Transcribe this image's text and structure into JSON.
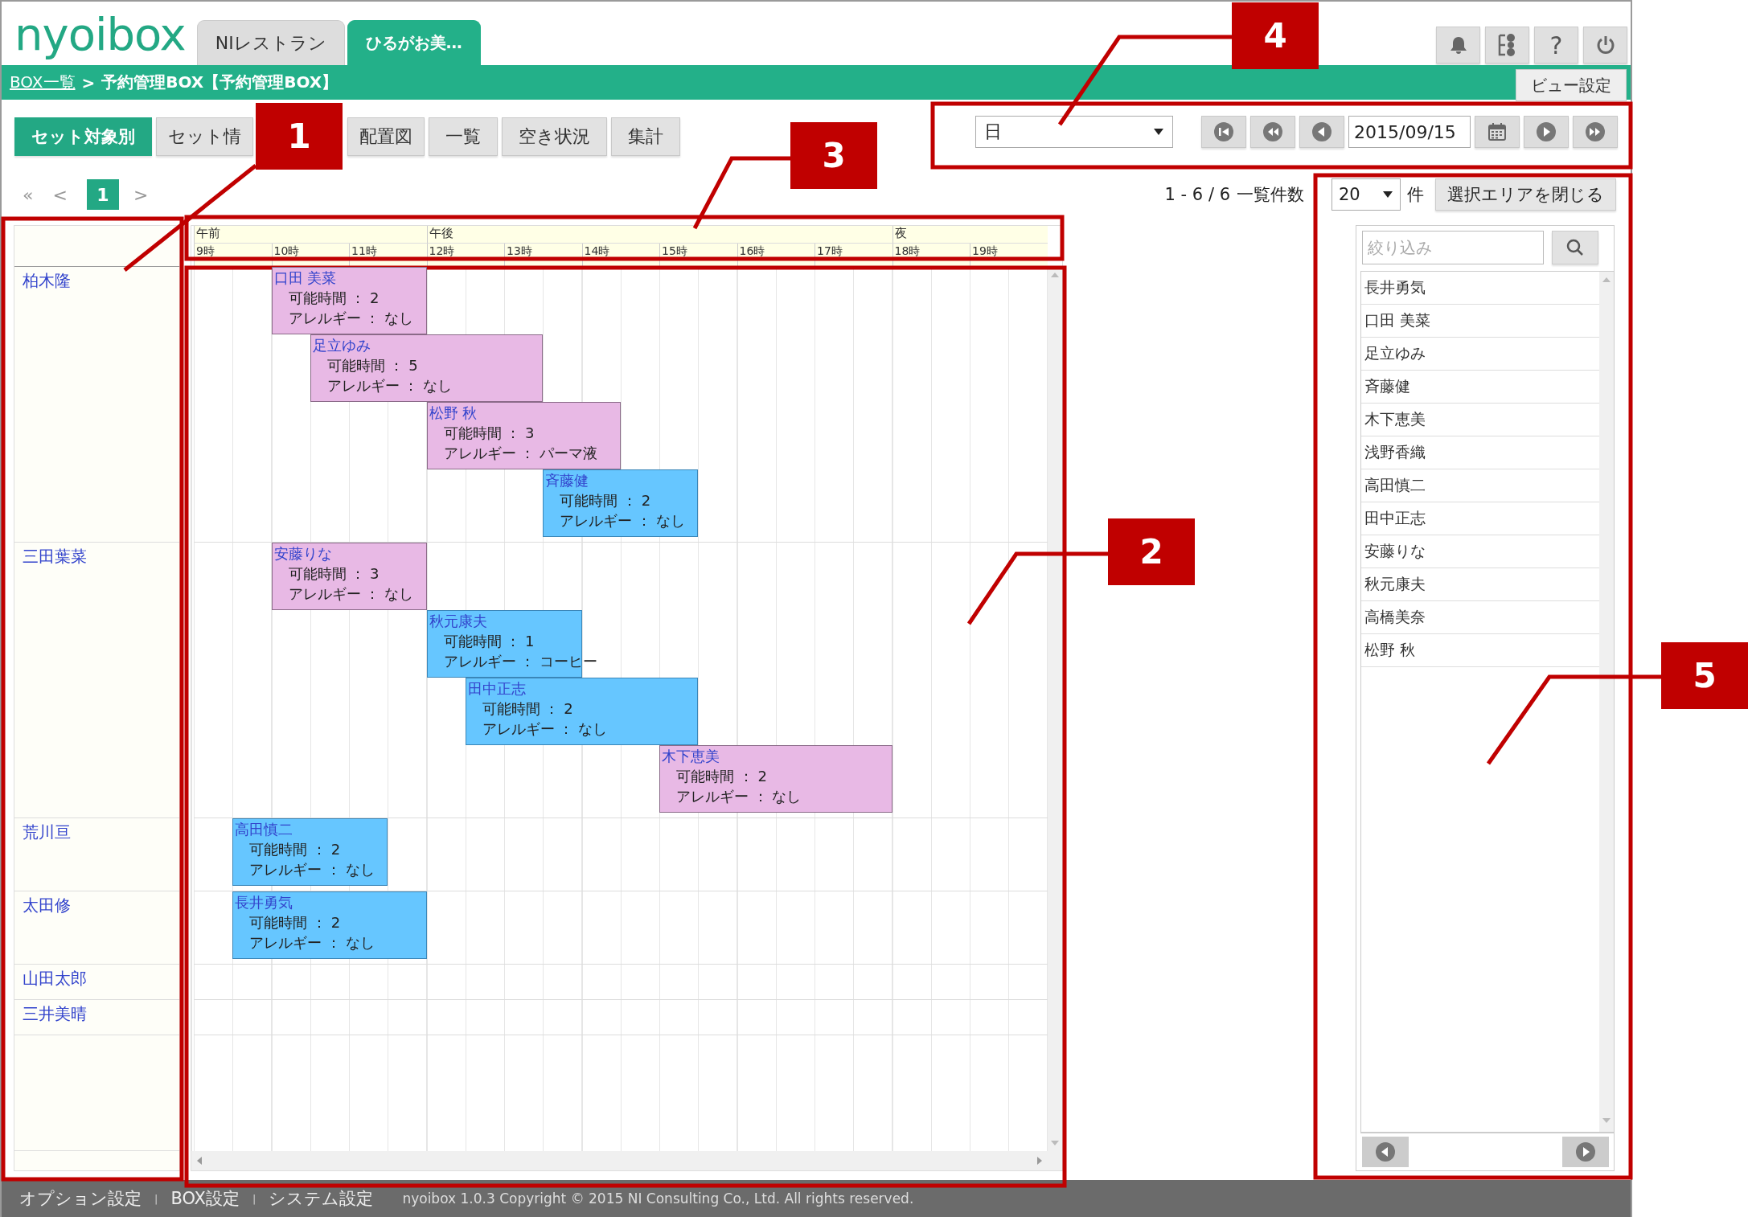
{
  "header": {
    "logo": "nyoibox",
    "tabs": [
      {
        "label": "NIレストラン",
        "selected": false
      },
      {
        "label": "ひるがお美…",
        "selected": true
      }
    ],
    "tool_buttons": [
      {
        "kind": "bell"
      },
      {
        "kind": "org"
      },
      {
        "kind": "help",
        "label": "?"
      },
      {
        "kind": "power"
      }
    ]
  },
  "breadcrumb": {
    "link": "BOX一覧",
    "separator": ">",
    "current": "予約管理BOX【予約管理BOX】"
  },
  "view_settings": "ビュー設定",
  "view_tabs": [
    {
      "label": "セット対象別",
      "selected": true
    },
    {
      "label": "セット情",
      "selected": false
    },
    {
      "label": "配置図",
      "selected": false
    },
    {
      "label": "一覧",
      "selected": false
    },
    {
      "label": "空き状況",
      "selected": false
    },
    {
      "label": "集計",
      "selected": false
    }
  ],
  "date_nav": {
    "period": "日",
    "date": "2015/09/15"
  },
  "pagination": {
    "first": "«",
    "prev": "<",
    "pages": [
      {
        "label": "1",
        "selected": true
      }
    ],
    "next": ">"
  },
  "count": {
    "range": "1 - 6 / 6",
    "label": "一覧件数",
    "page_size": "20",
    "unit": "件"
  },
  "close_selection": "選択エリアを閉じる",
  "timeline": {
    "periods": [
      {
        "label": "午前"
      },
      {
        "label": "午後"
      },
      {
        "label": "夜"
      }
    ],
    "hours": [
      "9時",
      "10時",
      "11時",
      "12時",
      "13時",
      "14時",
      "15時",
      "16時",
      "17時",
      "18時",
      "19時"
    ]
  },
  "rows": [
    {
      "name": "柏木隆",
      "bookings": [
        {
          "name": "口田 美菜",
          "details": [
            "可能時間 ： 2",
            "アレルギー ： なし"
          ],
          "color": "#e8b9e5"
        },
        {
          "name": "足立ゆみ",
          "details": [
            "可能時間 ： 5",
            "アレルギー ： なし"
          ],
          "color": "#e8b9e5"
        },
        {
          "name": "松野 秋",
          "details": [
            "可能時間 ： 3",
            "アレルギー ： パーマ液"
          ],
          "color": "#e8b9e5"
        },
        {
          "name": "斉藤健",
          "details": [
            "可能時間 ： 2",
            "アレルギー ： なし"
          ],
          "color": "#66c6ff"
        }
      ]
    },
    {
      "name": "三田葉菜",
      "bookings": [
        {
          "name": "安藤りな",
          "details": [
            "可能時間 ： 3",
            "アレルギー ： なし"
          ],
          "color": "#e8b9e5"
        },
        {
          "name": "秋元康夫",
          "details": [
            "可能時間 ： 1",
            "アレルギー ： コーヒー"
          ],
          "color": "#66c6ff"
        },
        {
          "name": "田中正志",
          "details": [
            "可能時間 ： 2",
            "アレルギー ： なし"
          ],
          "color": "#66c6ff"
        },
        {
          "name": "木下恵美",
          "details": [
            "可能時間 ： 2",
            "アレルギー ： なし"
          ],
          "color": "#e8b9e5"
        }
      ]
    },
    {
      "name": "荒川亘",
      "bookings": [
        {
          "name": "高田慎二",
          "details": [
            "可能時間 ： 2",
            "アレルギー ： なし"
          ],
          "color": "#66c6ff"
        }
      ]
    },
    {
      "name": "太田修",
      "bookings": [
        {
          "name": "長井勇気",
          "details": [
            "可能時間 ： 2",
            "アレルギー ： なし"
          ],
          "color": "#66c6ff"
        }
      ]
    },
    {
      "name": "山田太郎",
      "bookings": []
    },
    {
      "name": "三井美晴",
      "bookings": []
    }
  ],
  "side_panel": {
    "filter": {
      "placeholder": "絞り込み"
    },
    "candidates": [
      "長井勇気",
      "口田 美菜",
      "足立ゆみ",
      "斉藤健",
      "木下恵美",
      "浅野香織",
      "高田慎二",
      "田中正志",
      "安藤りな",
      "秋元康夫",
      "高橋美奈",
      "松野 秋"
    ]
  },
  "footer": {
    "items": [
      {
        "kind": "link",
        "text": "オプション設定"
      },
      {
        "kind": "separator",
        "text": "|"
      },
      {
        "kind": "link",
        "text": "BOX設定"
      },
      {
        "kind": "separator",
        "text": "|"
      },
      {
        "kind": "link",
        "text": "システム設定"
      }
    ],
    "copyright": "nyoibox 1.0.3 Copyright © 2015 NI Consulting Co., Ltd. All rights reserved."
  },
  "callouts": [
    {
      "number": "1"
    },
    {
      "number": "2"
    },
    {
      "number": "3"
    },
    {
      "number": "4"
    },
    {
      "number": "5"
    }
  ]
}
